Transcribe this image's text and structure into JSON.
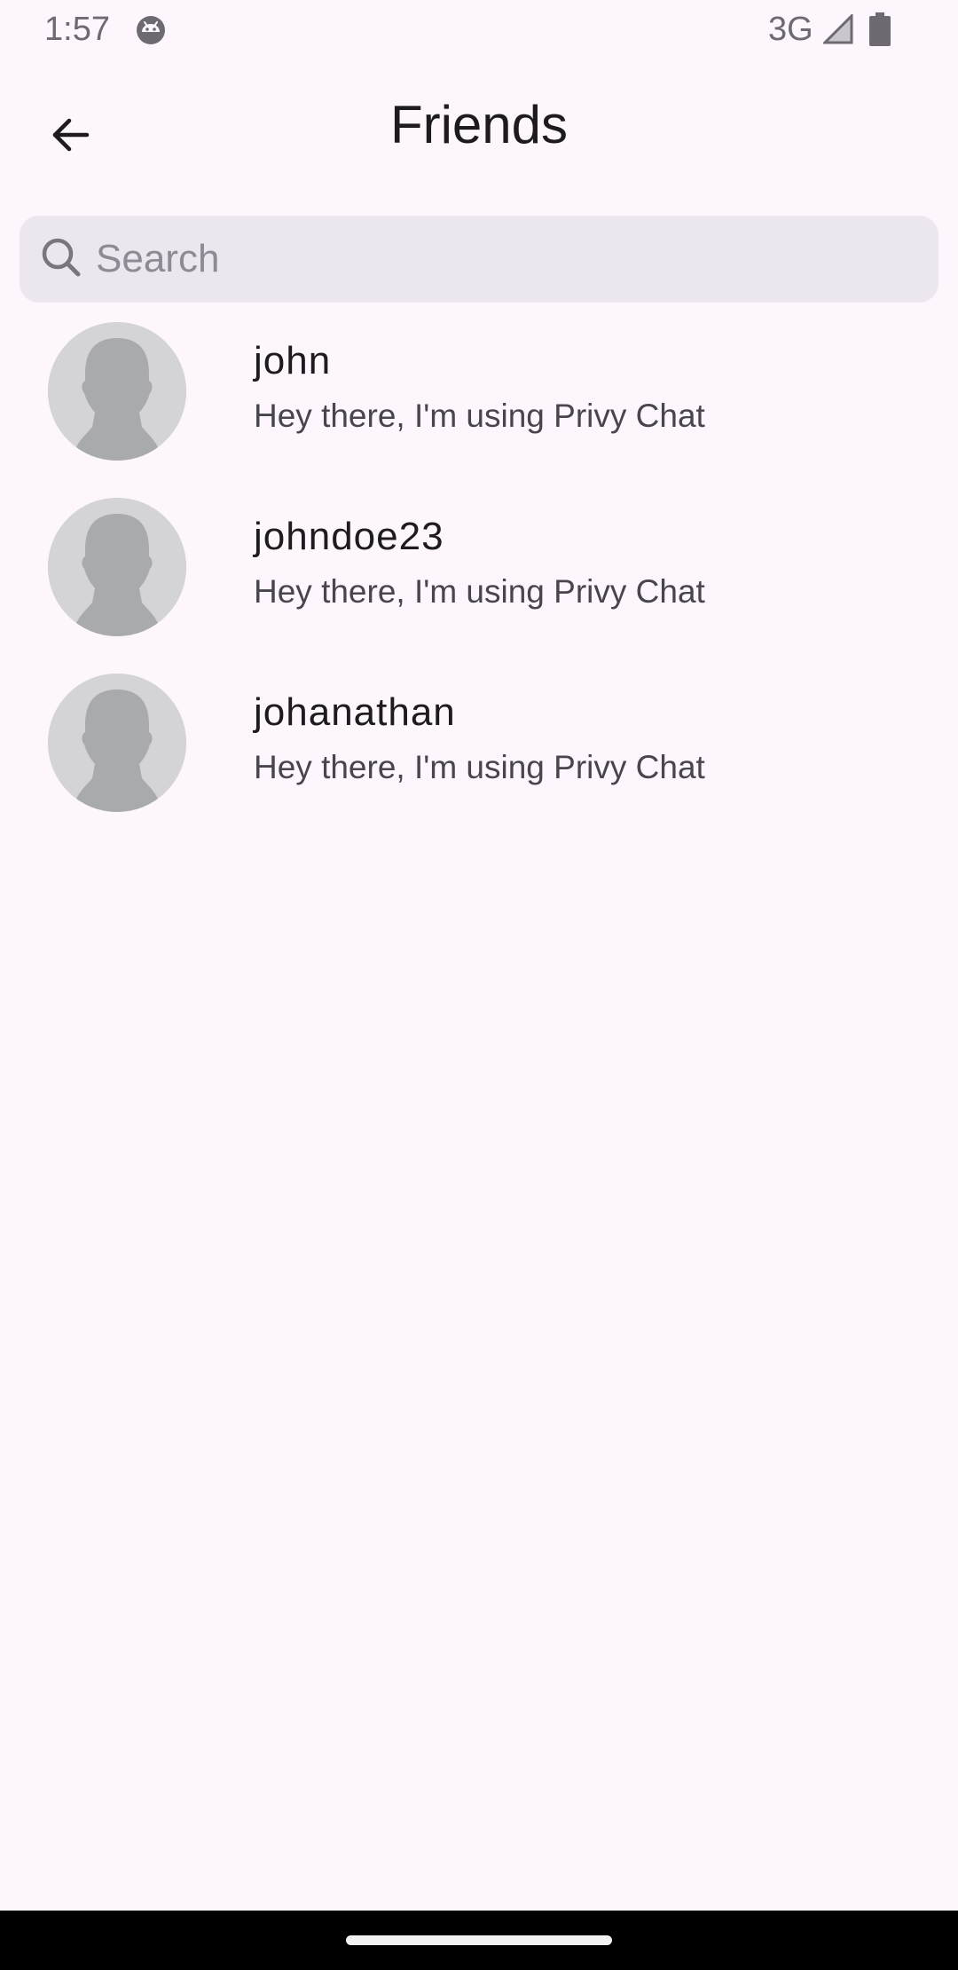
{
  "status_bar": {
    "time": "1:57",
    "network": "3G",
    "app_icon": "android-debug-icon",
    "signal_icon": "cell-signal-icon",
    "battery_icon": "battery-icon"
  },
  "app_bar": {
    "title": "Friends",
    "back_icon": "arrow-back-icon"
  },
  "search": {
    "placeholder": "Search",
    "value": "",
    "icon": "search-icon"
  },
  "friends": [
    {
      "name": "john",
      "status": "Hey there, I'm using Privy Chat",
      "avatar": "default-avatar-icon"
    },
    {
      "name": "johndoe23",
      "status": "Hey there, I'm using Privy Chat",
      "avatar": "default-avatar-icon"
    },
    {
      "name": "johanathan",
      "status": "Hey there, I'm using Privy Chat",
      "avatar": "default-avatar-icon"
    }
  ],
  "colors": {
    "background": "#FDF7FD",
    "search_background": "#ECE7EE",
    "avatar_background": "#D4D4D6",
    "avatar_silhouette": "#A9AAAC",
    "text_primary": "#1D1B20",
    "text_secondary": "#48454E"
  }
}
